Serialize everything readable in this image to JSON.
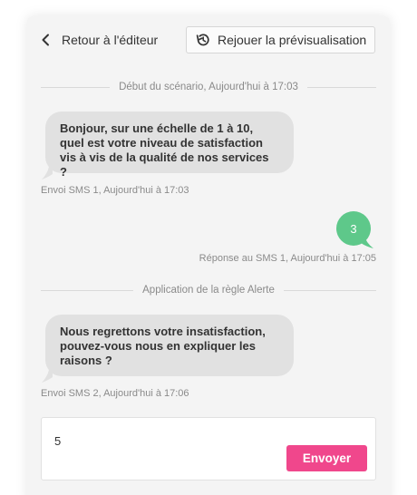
{
  "header": {
    "back_label": "Retour à l'éditeur",
    "replay_label": "Rejouer la prévisualisation"
  },
  "timeline": {
    "start_divider": "Début du scénario, Aujourd'hui à 17:03",
    "sms1": {
      "lines": [
        "Bonjour, sur une échelle de 1 à 10,",
        "quel est votre niveau de satisfaction",
        "vis à vis de la qualité de nos services ?"
      ],
      "meta": "Envoi SMS 1, Aujourd'hui à 17:03"
    },
    "reply1": {
      "text": "3",
      "meta": "Réponse au SMS 1, Aujourd'hui à 17:05"
    },
    "rule_divider": "Application de la règle Alerte",
    "sms2": {
      "lines": [
        "Nous regrettons votre insatisfaction,",
        "pouvez-vous nous en expliquer les",
        "raisons ?"
      ],
      "meta": "Envoi SMS 2, Aujourd'hui à 17:06"
    }
  },
  "composer": {
    "value": "5",
    "send_label": "Envoyer"
  },
  "colors": {
    "incoming_bubble": "#e1e1e1",
    "outgoing_bubble": "#5ec88a",
    "send_button": "#f0478c"
  },
  "icons": {
    "back": "chevron-left-icon",
    "replay": "history-replay-icon"
  }
}
